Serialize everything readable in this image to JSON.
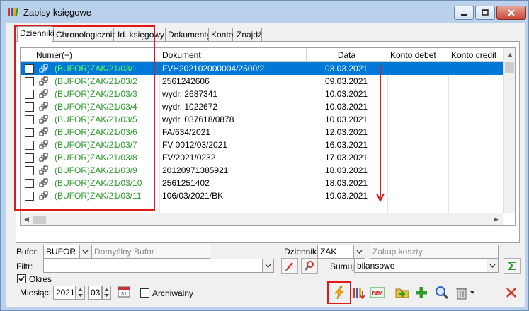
{
  "window": {
    "title": "Zapisy księgowe"
  },
  "tabs": [
    "Dzienniki",
    "Chronologicznie",
    "Id. księgowy",
    "Dokumenty",
    "Konto",
    "Znajdź"
  ],
  "grid": {
    "headers": [
      "Numer(+)",
      "Dokument",
      "Data",
      "Konto debet",
      "Konto credit"
    ],
    "rows": [
      {
        "numer": "(BUFOR)ZAK/21/03/1",
        "dokument": "FVH202102000004/2500/2",
        "data": "03.03.2021"
      },
      {
        "numer": "(BUFOR)ZAK/21/03/2",
        "dokument": "2561242606",
        "data": "09.03.2021"
      },
      {
        "numer": "(BUFOR)ZAK/21/03/3",
        "dokument": "wydr. 2687341",
        "data": "10.03.2021"
      },
      {
        "numer": "(BUFOR)ZAK/21/03/4",
        "dokument": "wydr. 1022672",
        "data": "10.03.2021"
      },
      {
        "numer": "(BUFOR)ZAK/21/03/5",
        "dokument": "wydr. 037618/0878",
        "data": "10.03.2021"
      },
      {
        "numer": "(BUFOR)ZAK/21/03/6",
        "dokument": "FA/634/2021",
        "data": "12.03.2021"
      },
      {
        "numer": "(BUFOR)ZAK/21/03/7",
        "dokument": "FV 0012/03/2021",
        "data": "16.03.2021"
      },
      {
        "numer": "(BUFOR)ZAK/21/03/8",
        "dokument": "FV/2021/0232",
        "data": "17.03.2021"
      },
      {
        "numer": "(BUFOR)ZAK/21/03/9",
        "dokument": "20120971385921",
        "data": "18.03.2021"
      },
      {
        "numer": "(BUFOR)ZAK/21/03/10",
        "dokument": "2561251402",
        "data": "18.03.2021"
      },
      {
        "numer": "(BUFOR)ZAK/21/03/11",
        "dokument": "106/03/2021/BK",
        "data": "19.03.2021"
      }
    ]
  },
  "filters": {
    "bufor_label": "Bufor:",
    "bufor_value": "BUFOR",
    "bufor_desc": "Domyślny Bufor",
    "dziennik_label": "Dziennik:",
    "dziennik_value": "ZAK",
    "dziennik_desc": "Zakup koszty",
    "filtr_label": "Filtr:",
    "sumuj_label": "Sumuj:",
    "sumuj_value": "bilansowe"
  },
  "okres": {
    "label": "Okres",
    "miesiac_label": "Miesiąc:",
    "year": "2021",
    "month": "03",
    "archiwalny_label": "Archiwalny"
  },
  "colors": {
    "accent": "#0078d7",
    "highlight_box": "#e01818",
    "numer_text": "#2e9a2e"
  }
}
